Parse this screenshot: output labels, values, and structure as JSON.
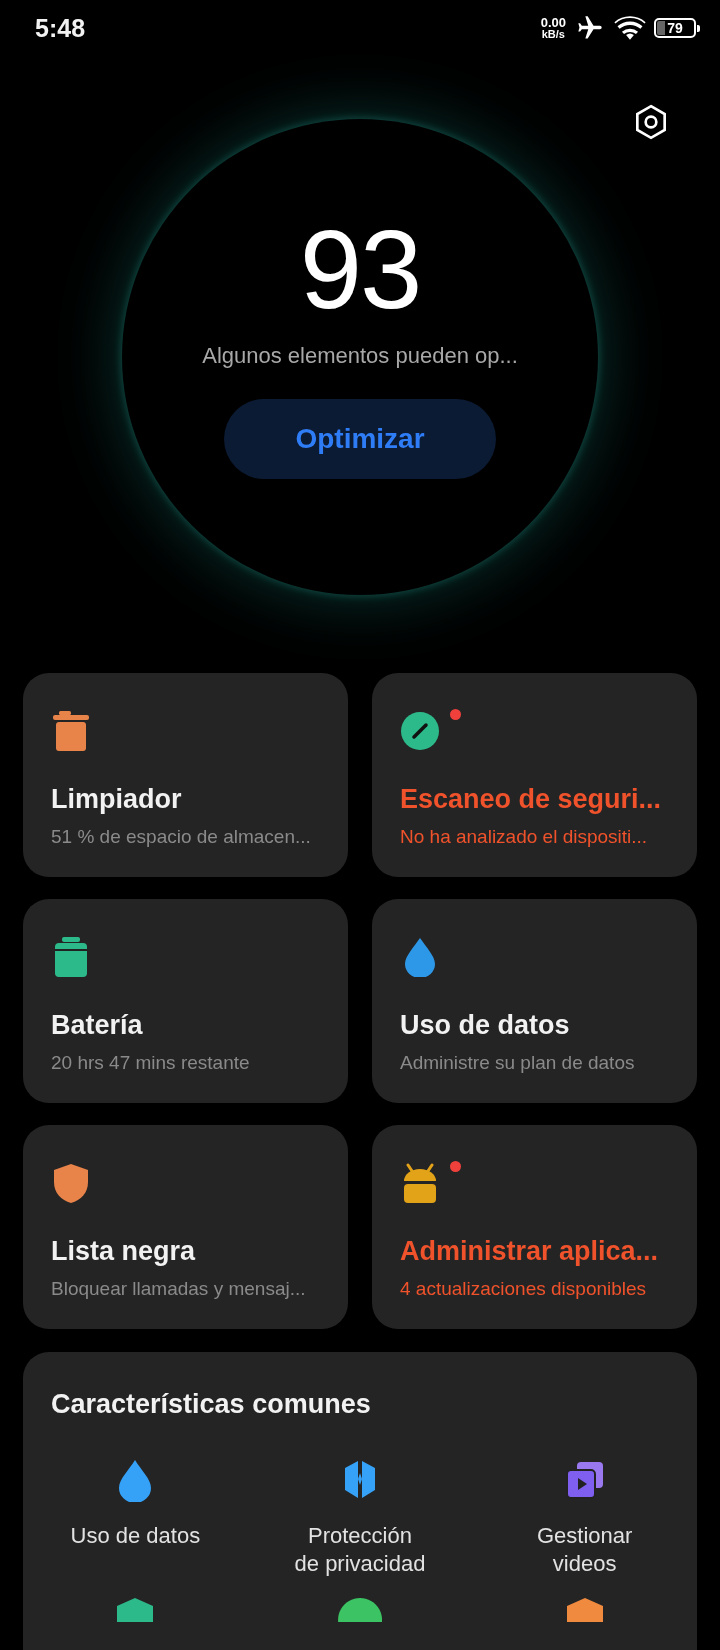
{
  "status_bar": {
    "time": "5:48",
    "net_speed_value": "0.00",
    "net_speed_unit": "kB/s",
    "battery": "79"
  },
  "score": {
    "value": "93",
    "message": "Algunos elementos pueden op...",
    "button": "Optimizar"
  },
  "cards": [
    {
      "title": "Limpiador",
      "subtitle": "51 % de espacio de almacen...",
      "alert": false
    },
    {
      "title": "Escaneo de seguri...",
      "subtitle": "No ha analizado el dispositi...",
      "alert": true
    },
    {
      "title": "Batería",
      "subtitle": "20 hrs 47 mins  restante",
      "alert": false
    },
    {
      "title": "Uso de datos",
      "subtitle": "Administre su plan de datos",
      "alert": false
    },
    {
      "title": "Lista negra",
      "subtitle": "Bloquear llamadas y mensaj...",
      "alert": false
    },
    {
      "title": "Administrar aplica...",
      "subtitle": "4 actualizaciones disponibles",
      "alert": true
    }
  ],
  "common_features": {
    "title": "Características comunes",
    "items": [
      {
        "label": "Uso de datos"
      },
      {
        "label": "Protección\nde privacidad"
      },
      {
        "label": "Gestionar\nvideos"
      }
    ]
  }
}
